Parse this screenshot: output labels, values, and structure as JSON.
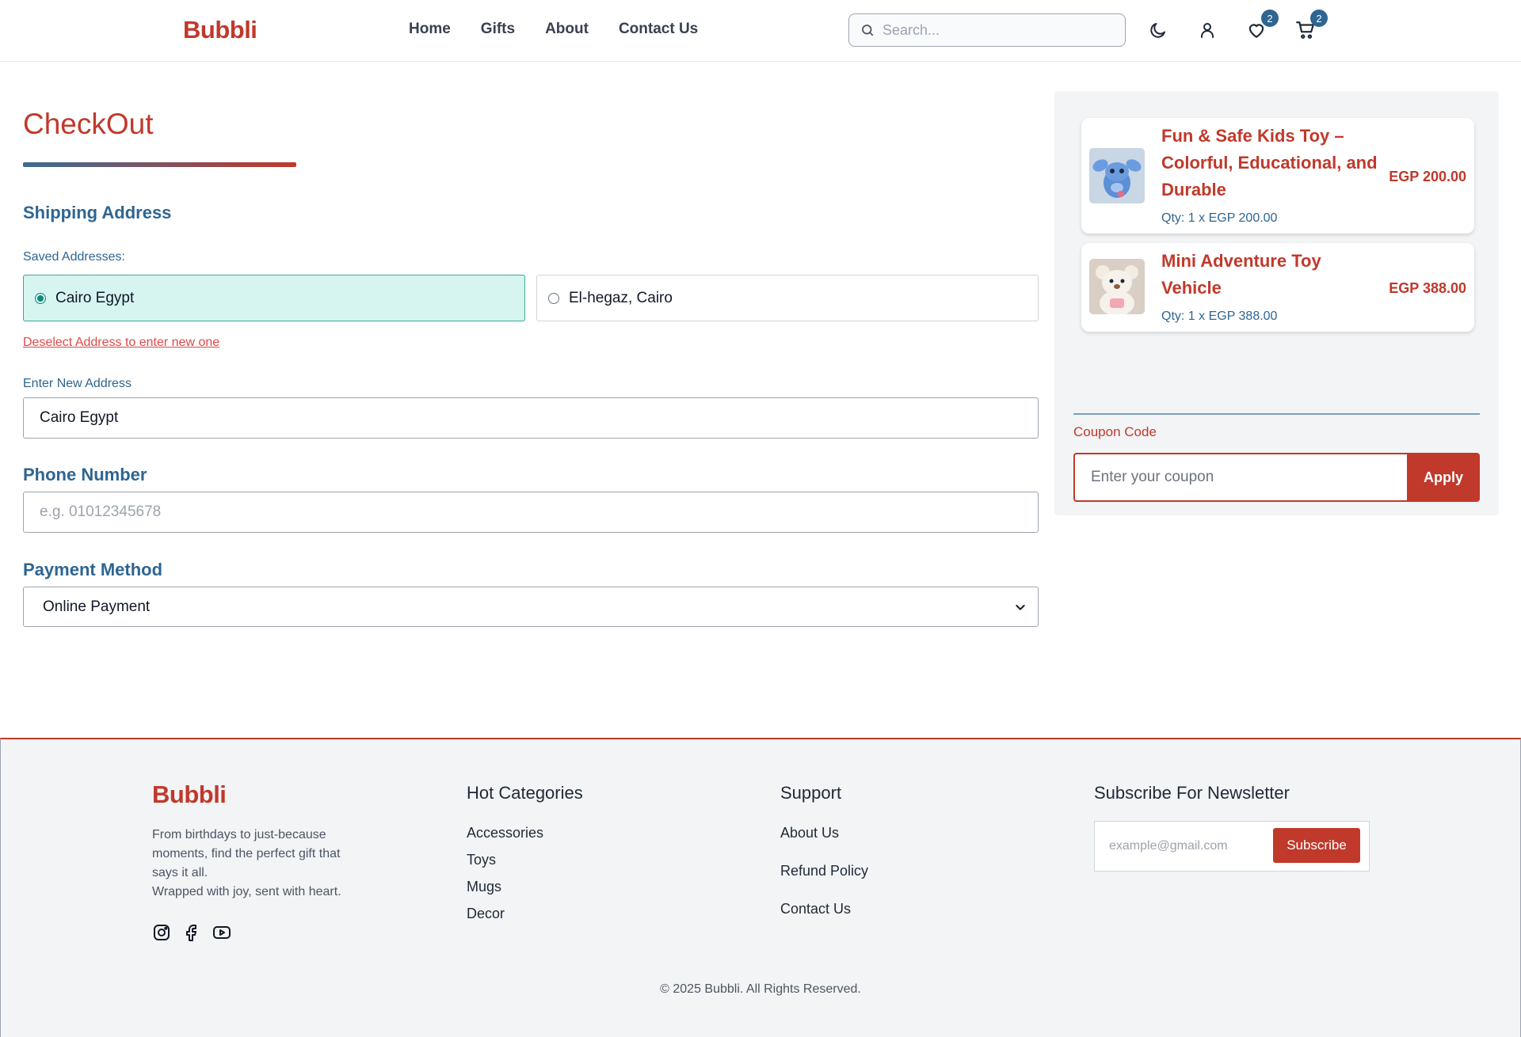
{
  "header": {
    "logo": "Bubbli",
    "nav": [
      "Home",
      "Gifts",
      "About",
      "Contact Us"
    ],
    "search_placeholder": "Search...",
    "wishlist_count": "2",
    "cart_count": "2"
  },
  "checkout": {
    "title": "CheckOut",
    "shipping_heading": "Shipping Address",
    "saved_label": "Saved Addresses:",
    "saved_addresses": [
      "Cairo Egypt",
      "El-hegaz, Cairo"
    ],
    "deselect_link": "Deselect Address to enter new one",
    "new_address_label": "Enter New Address",
    "new_address_value": "Cairo Egypt",
    "phone_heading": "Phone Number",
    "phone_placeholder": "e.g. 01012345678",
    "payment_heading": "Payment Method",
    "payment_selected": "Online Payment"
  },
  "summary": {
    "items": [
      {
        "name_lines": [
          "Fun & Safe Kids Toy –",
          "Colorful, Educational, and",
          "Durable"
        ],
        "qty": "Qty: 1 x EGP 200.00",
        "price": "EGP 200.00"
      },
      {
        "name_lines": [
          "Mini Adventure Toy",
          "Vehicle"
        ],
        "qty": "Qty: 1 x EGP 388.00",
        "price": "EGP 388.00"
      }
    ],
    "coupon_label": "Coupon Code",
    "coupon_placeholder": "Enter your coupon",
    "apply_label": "Apply"
  },
  "footer": {
    "logo": "Bubbli",
    "description_lines": [
      "From birthdays to just-because",
      "moments, find the perfect gift that",
      "says it all.",
      "Wrapped with joy, sent with heart."
    ],
    "categories_heading": "Hot Categories",
    "categories": [
      "Accessories",
      "Toys",
      "Mugs",
      "Decor"
    ],
    "support_heading": "Support",
    "support_links": [
      "About Us",
      "Refund Policy",
      "Contact Us"
    ],
    "newsletter_heading": "Subscribe For Newsletter",
    "newsletter_placeholder": "example@gmail.com",
    "subscribe_label": "Subscribe",
    "copyright": "© 2025 Bubbli. All Rights Reserved."
  },
  "colors": {
    "brand_red": "#c0392b",
    "brand_blue": "#2e6591",
    "selected_teal": "#d6f5f1"
  },
  "icons": [
    "search-icon",
    "moon-icon",
    "user-icon",
    "heart-icon",
    "cart-icon",
    "instagram-icon",
    "facebook-icon",
    "youtube-icon",
    "chevron-down-icon"
  ]
}
